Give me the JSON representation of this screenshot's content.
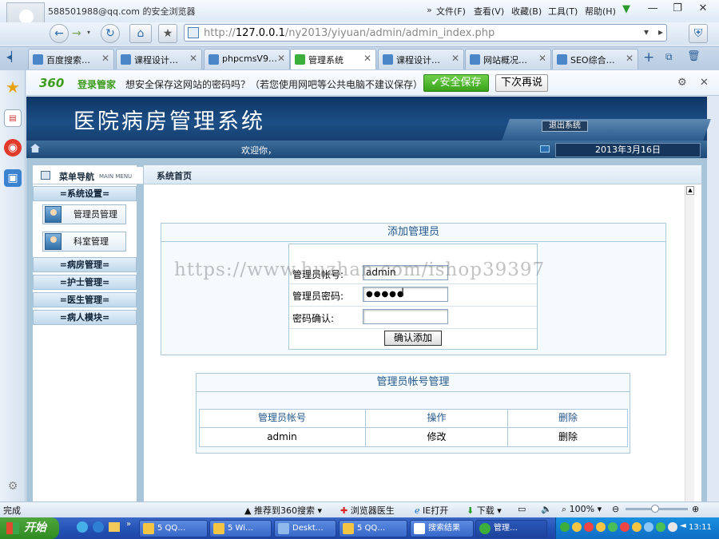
{
  "browser": {
    "window_title": "588501988@qq.com 的安全浏览器",
    "menu": [
      "文件(F)",
      "查看(V)",
      "收藏(B)",
      "工具(T)",
      "帮助(H)"
    ],
    "window_controls": [
      "—",
      "❐",
      "✕"
    ],
    "url_prefix": "http://",
    "url_host": "127.0.0.1",
    "url_path": "/ny2013/yiyuan/admin/admin_index.php",
    "tabs": [
      {
        "label": "百度搜索…",
        "active": false
      },
      {
        "label": "课程设计…",
        "active": false
      },
      {
        "label": "phpcmsV9…",
        "active": false
      },
      {
        "label": "管理系统",
        "active": true
      },
      {
        "label": "课程设计…",
        "active": false
      },
      {
        "label": "网站概况…",
        "active": false
      },
      {
        "label": "SEO综合…",
        "active": false
      }
    ],
    "password_bar": {
      "brand": "360",
      "brand_label": "登录管家",
      "message": "想安全保存这网站的密码吗？（若您使用网吧等公共电脑不建议保存）",
      "save_label": "安全保存",
      "later_label": "下次再说"
    }
  },
  "page": {
    "system_title": "医院病房管理系统",
    "logout_label": "退出系统",
    "welcome": "欢迎你，",
    "date": "2013年3月16日",
    "sidebar": {
      "title": "菜单导航",
      "subtitle": "MAIN MENU",
      "groups": [
        {
          "label": "=系统设置="
        },
        {
          "label": "=病房管理="
        },
        {
          "label": "=护士管理="
        },
        {
          "label": "=医生管理="
        },
        {
          "label": "=病人模块="
        }
      ],
      "items": [
        {
          "label": "管理员管理"
        },
        {
          "label": "科室管理"
        }
      ]
    },
    "breadcrumb": "系统首页",
    "add_admin": {
      "title": "添加管理员",
      "account_label": "管理员帐号:",
      "account_value": "admin",
      "password_label": "管理员密码:",
      "password_value": "●●●●●",
      "confirm_label": "密码确认:",
      "confirm_value": "",
      "submit_label": "确认添加"
    },
    "account_mgmt": {
      "title": "管理员帐号管理",
      "columns": [
        "管理员帐号",
        "操作",
        "删除"
      ],
      "rows": [
        {
          "account": "admin",
          "edit": "修改",
          "delete": "删除"
        }
      ]
    },
    "watermark": "https://www.huzhan.com/ishop39397"
  },
  "statusbar": {
    "status": "完成",
    "items": [
      "推荐到360搜索",
      "浏览器医生",
      "IE打开",
      "下载"
    ],
    "zoom": "100%"
  },
  "taskbar": {
    "start_label": "开始",
    "items": [
      {
        "label": "5 QQ…"
      },
      {
        "label": "5 Wi…"
      },
      {
        "label": "Deskt…"
      },
      {
        "label": "5 QQ…"
      },
      {
        "label": "搜索结果"
      },
      {
        "label": "管理…"
      }
    ],
    "clock": "13:11"
  }
}
